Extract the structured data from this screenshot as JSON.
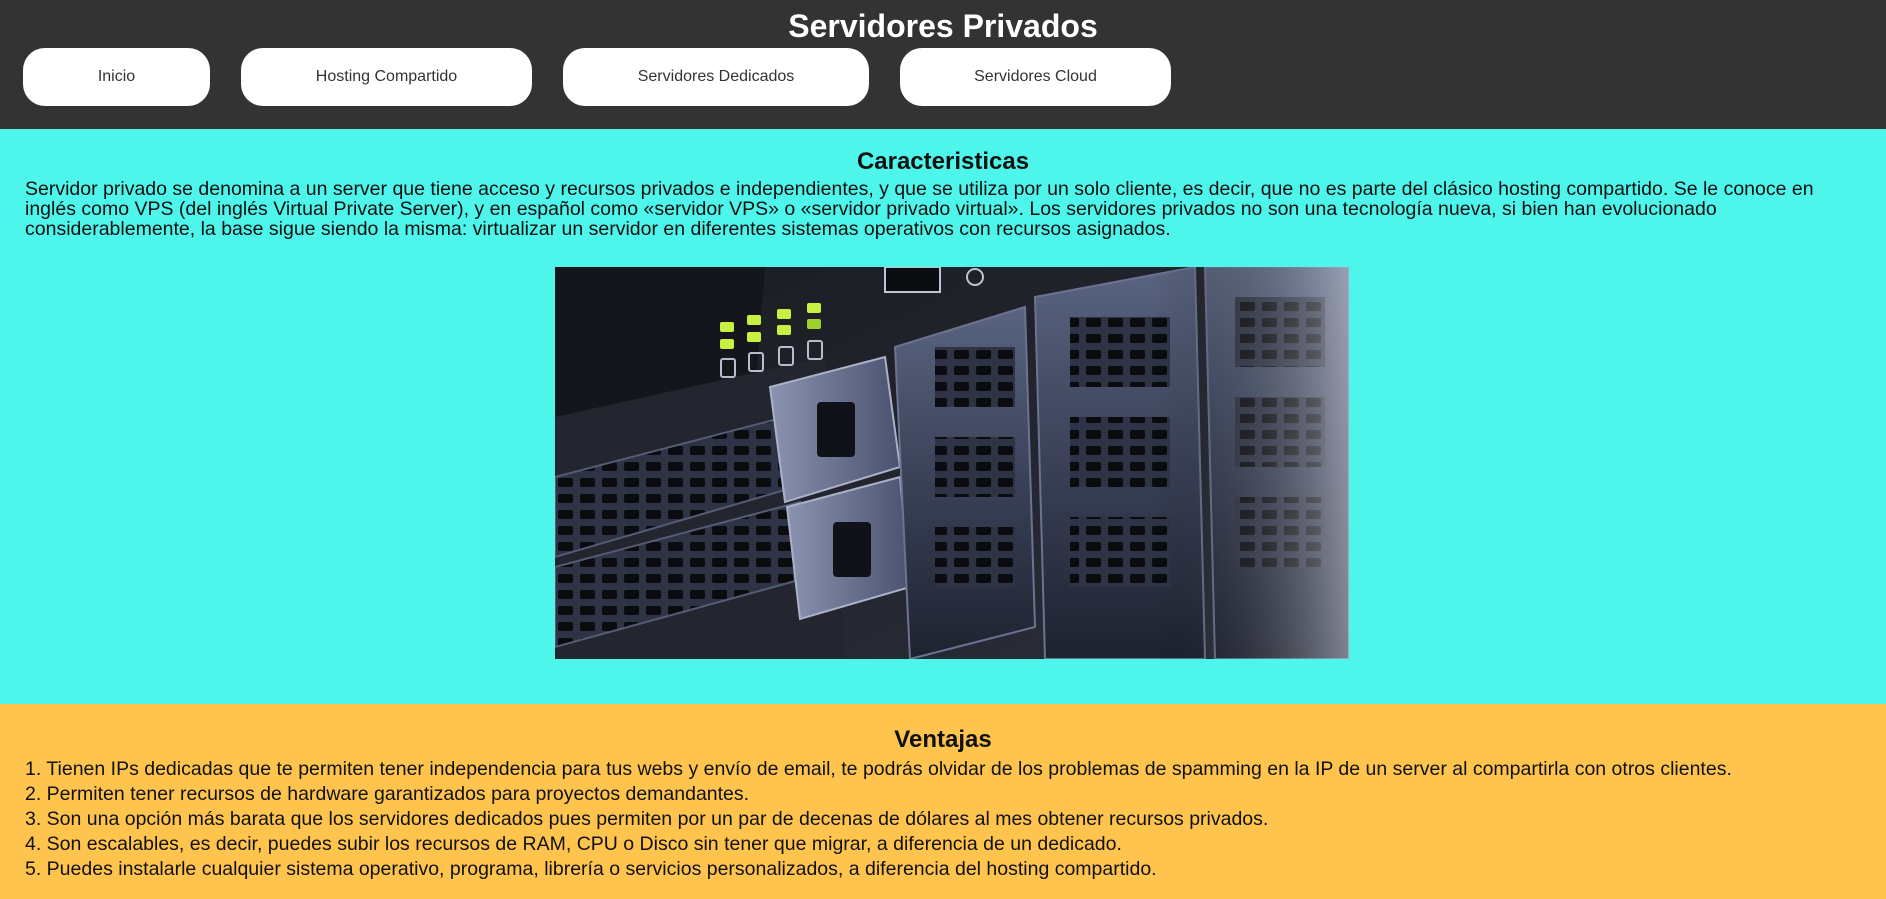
{
  "header": {
    "title": "Servidores Privados",
    "nav": [
      {
        "label": "Inicio"
      },
      {
        "label": "Hosting Compartido"
      },
      {
        "label": "Servidores Dedicados"
      },
      {
        "label": "Servidores Cloud"
      }
    ]
  },
  "features": {
    "heading": "Caracteristicas",
    "text": "Servidor privado se denomina a un server que tiene acceso y recursos privados e independientes, y que se utiliza por un solo cliente, es decir, que no es parte del clásico hosting compartido. Se le conoce en inglés como VPS (del inglés Virtual Private Server), y en español como «servidor VPS» o «servidor privado virtual». Los servidores privados no son una tecnología nueva, si bien han evolucionado considerablemente, la base sigue siendo la misma: virtualizar un servidor en diferentes sistemas operativos con recursos asignados.",
    "image_icon": "server-rack-photo"
  },
  "advantages": {
    "heading": "Ventajas",
    "items": [
      "1. Tienen IPs dedicadas que te permiten tener independencia para tus webs y envío de email, te podrás olvidar de los problemas de spamming en la IP de un server al compartirla con otros clientes.",
      "2. Permiten tener recursos de hardware garantizados para proyectos demandantes.",
      "3. Son una opción más barata que los servidores dedicados pues permiten por un par de decenas de dólares al mes obtener recursos privados.",
      "4. Son escalables, es decir, puedes subir los recursos de RAM, CPU o Disco sin tener que migrar, a diferencia de un dedicado.",
      "5. Puedes instalarle cualquier sistema operativo, programa, librería o servicios personalizados, a diferencia del hosting compartido."
    ]
  },
  "colors": {
    "header_bg": "#333333",
    "features_bg": "#4df5ea",
    "advantages_bg": "#ffc44d"
  }
}
